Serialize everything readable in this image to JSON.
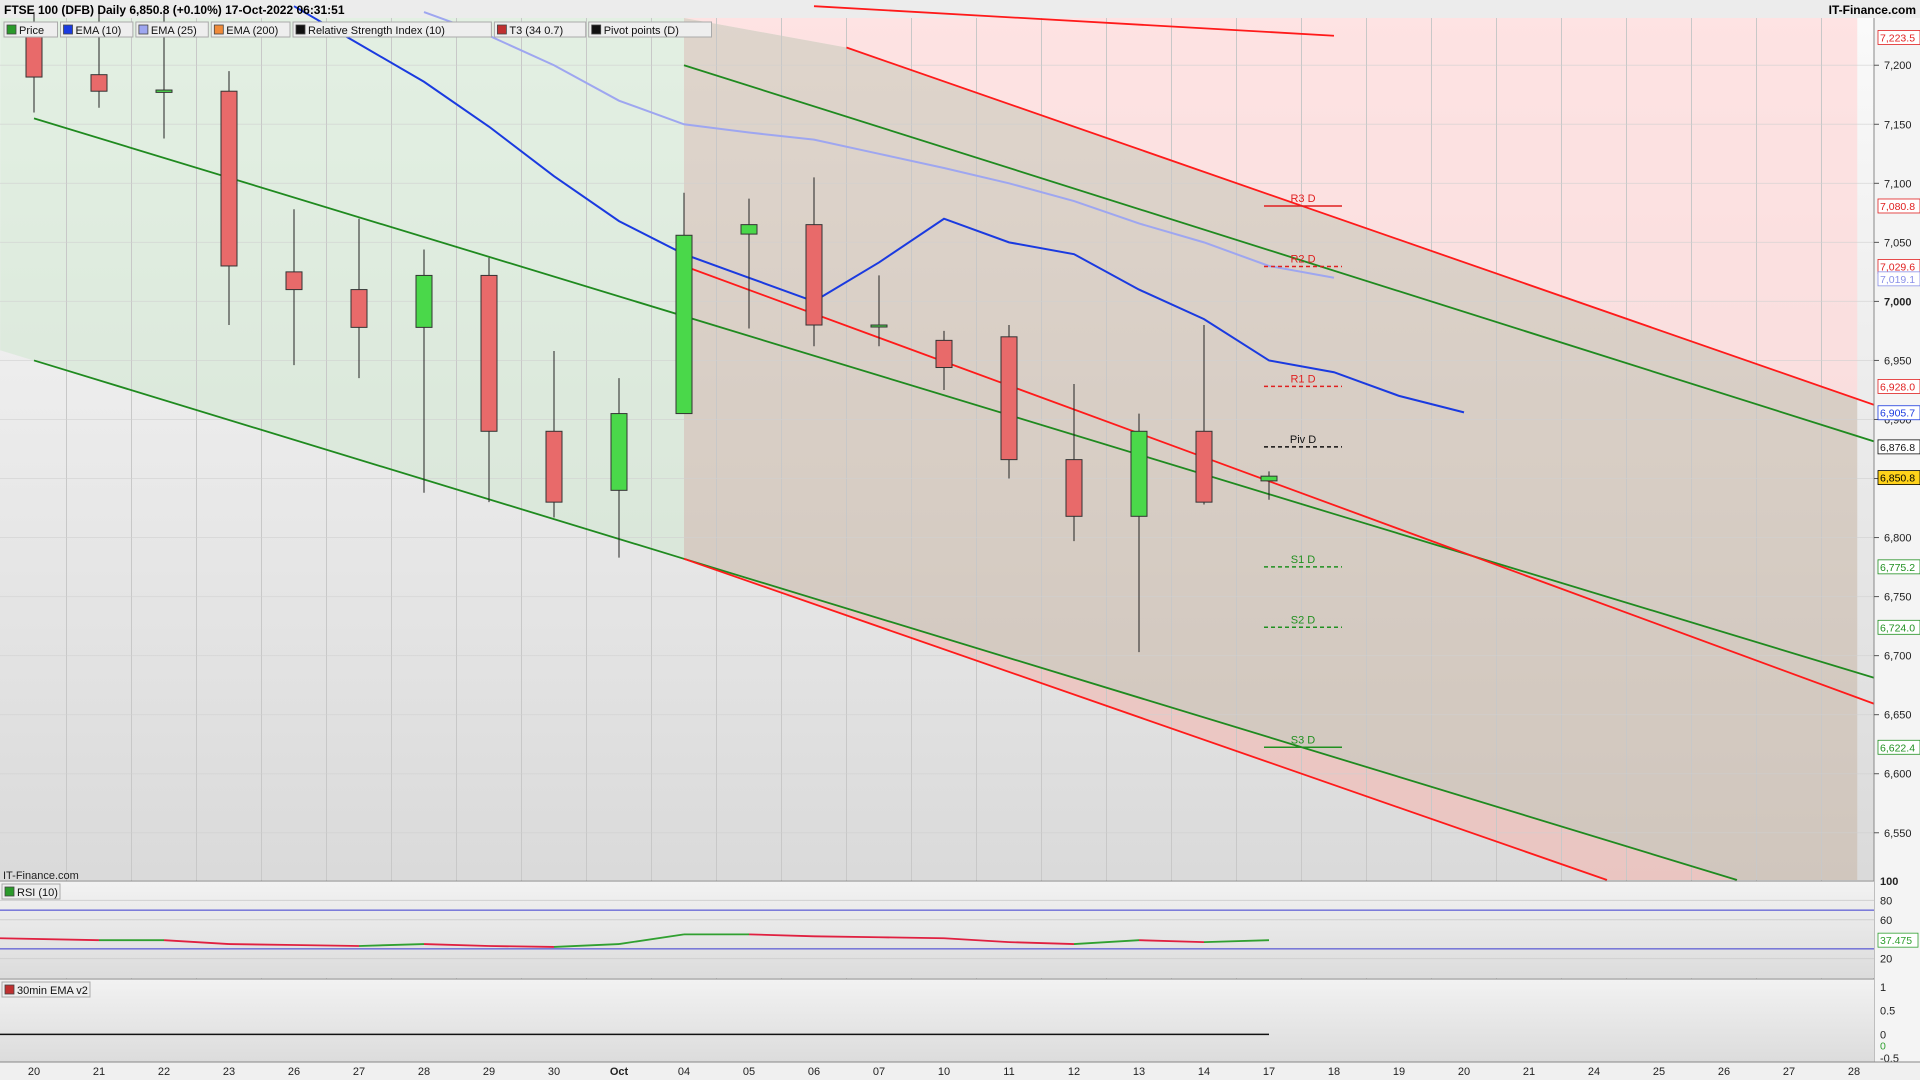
{
  "header": {
    "title": "FTSE 100 (DFB) Daily 6,850.8 (+0.10%) 17-Oct-2022 06:31:51",
    "site": "IT-Finance.com"
  },
  "legend": [
    {
      "label": "Price",
      "color": "#2a9a2a"
    },
    {
      "label": "EMA (10)",
      "color": "#1a3ae0"
    },
    {
      "label": "EMA (25)",
      "color": "#9ea6f0"
    },
    {
      "label": "EMA (200)",
      "color": "#f08a3a"
    },
    {
      "label": "Relative Strength Index (10)",
      "color": "#111111"
    },
    {
      "label": "T3 (34 0.7)",
      "color": "#c03030"
    },
    {
      "label": "Pivot points (D)",
      "color": "#111111"
    }
  ],
  "watermark": "IT-Finance.com",
  "rsi_label": "RSI (10)",
  "ema30_label": "30min EMA v2",
  "chart_data": {
    "type": "candlestick",
    "x_labels": [
      "20",
      "21",
      "22",
      "23",
      "26",
      "27",
      "28",
      "29",
      "30",
      "Oct",
      "04",
      "05",
      "06",
      "07",
      "10",
      "11",
      "12",
      "13",
      "14",
      "17",
      "18",
      "19",
      "20",
      "21",
      "24",
      "25",
      "26",
      "27",
      "28"
    ],
    "y_ticks": [
      "7,200",
      "7,150",
      "7,100",
      "7,050",
      "7,000",
      "6,950",
      "6,900",
      "6,850",
      "6,800",
      "6,750",
      "6,700",
      "6,650",
      "6,600",
      "6,550"
    ],
    "y_range": [
      6510,
      7240
    ],
    "candles": [
      {
        "date": "20",
        "open": 7227,
        "high": 7245,
        "low": 7160,
        "close": 7190
      },
      {
        "date": "21",
        "open": 7192,
        "high": 7245,
        "low": 7164,
        "close": 7178
      },
      {
        "date": "22",
        "open": 7177,
        "high": 7245,
        "low": 7138,
        "close": 7179
      },
      {
        "date": "23",
        "open": 7178,
        "high": 7195,
        "low": 6980,
        "close": 7030
      },
      {
        "date": "26",
        "open": 7025,
        "high": 7078,
        "low": 6946,
        "close": 7010
      },
      {
        "date": "27",
        "open": 7010,
        "high": 7070,
        "low": 6935,
        "close": 6978
      },
      {
        "date": "28",
        "open": 6978,
        "high": 7044,
        "low": 6838,
        "close": 7022
      },
      {
        "date": "29",
        "open": 7022,
        "high": 7037,
        "low": 6830,
        "close": 6890
      },
      {
        "date": "30",
        "open": 6890,
        "high": 6958,
        "low": 6817,
        "close": 6830
      },
      {
        "date": "Oct",
        "open": 6840,
        "high": 6935,
        "low": 6783,
        "close": 6905
      },
      {
        "date": "04",
        "open": 6905,
        "high": 7092,
        "low": 6905,
        "close": 7056
      },
      {
        "date": "05",
        "open": 7057,
        "high": 7087,
        "low": 6977,
        "close": 7065
      },
      {
        "date": "06",
        "open": 7065,
        "high": 7105,
        "low": 6962,
        "close": 6980
      },
      {
        "date": "07",
        "open": 6980,
        "high": 7022,
        "low": 6962,
        "close": 6980
      },
      {
        "date": "10",
        "open": 6967,
        "high": 6975,
        "low": 6925,
        "close": 6944
      },
      {
        "date": "11",
        "open": 6970,
        "high": 6980,
        "low": 6850,
        "close": 6866
      },
      {
        "date": "12",
        "open": 6866,
        "high": 6930,
        "low": 6797,
        "close": 6818
      },
      {
        "date": "13",
        "open": 6818,
        "high": 6905,
        "low": 6703,
        "close": 6890
      },
      {
        "date": "14",
        "open": 6890,
        "high": 6980,
        "low": 6828,
        "close": 6830
      },
      {
        "date": "17",
        "open": 6848,
        "high": 6856,
        "low": 6832,
        "close": 6852
      }
    ],
    "ema10": [
      [
        4,
        7250
      ],
      [
        5,
        7218
      ],
      [
        6,
        7186
      ],
      [
        7,
        7148
      ],
      [
        8,
        7106
      ],
      [
        9,
        7068
      ],
      [
        10,
        7040
      ],
      [
        11,
        7020
      ],
      [
        12,
        7000
      ],
      [
        13,
        7033
      ],
      [
        14,
        7070
      ],
      [
        15,
        7050
      ],
      [
        16,
        7040
      ],
      [
        17,
        7010
      ],
      [
        18,
        6985
      ],
      [
        19,
        6950
      ],
      [
        20,
        6940
      ],
      [
        21,
        6920
      ],
      [
        22,
        6906
      ]
    ],
    "ema25": [
      [
        6,
        7245
      ],
      [
        7,
        7225
      ],
      [
        8,
        7200
      ],
      [
        9,
        7170
      ],
      [
        10,
        7150
      ],
      [
        11,
        7143
      ],
      [
        12,
        7137
      ],
      [
        13,
        7125
      ],
      [
        14,
        7113
      ],
      [
        15,
        7100
      ],
      [
        16,
        7085
      ],
      [
        17,
        7066
      ],
      [
        18,
        7050
      ],
      [
        19,
        7030
      ],
      [
        20,
        7020
      ]
    ],
    "trend_lines": {
      "green_upper": [
        [
          0,
          7155
        ],
        [
          20,
          6820
        ],
        [
          30,
          6653
        ]
      ],
      "green_mid": [
        [
          10,
          7200
        ],
        [
          30,
          6852
        ]
      ],
      "green_lower": [
        [
          0,
          6950
        ],
        [
          10,
          6782
        ],
        [
          26.2,
          6510
        ]
      ],
      "red_upper": [
        [
          12,
          7250
        ],
        [
          20,
          7225
        ]
      ],
      "red_upper2": [
        [
          12.5,
          7215
        ],
        [
          30,
          6880
        ]
      ],
      "red_mid": [
        [
          10,
          7030
        ],
        [
          30,
          6625
        ]
      ],
      "red_lower": [
        [
          10,
          6782
        ],
        [
          24.2,
          6510
        ]
      ]
    },
    "shade": {
      "green_end_index": 10,
      "red_start_index": 10
    },
    "pivots": [
      {
        "label": "R3 D",
        "value": 7080.8,
        "color": "#e02020",
        "style": "solid"
      },
      {
        "label": "R2 D",
        "value": 7029.6,
        "color": "#e02020",
        "style": "dashed"
      },
      {
        "label": "R1 D",
        "value": 6928.0,
        "color": "#e02020",
        "style": "dashed"
      },
      {
        "label": "Piv D",
        "value": 6876.8,
        "color": "#111111",
        "style": "dashed"
      },
      {
        "label": "S1 D",
        "value": 6775.2,
        "color": "#209020",
        "style": "dashed"
      },
      {
        "label": "S2 D",
        "value": 6724.0,
        "color": "#209020",
        "style": "dashed"
      },
      {
        "label": "S3 D",
        "value": 6622.4,
        "color": "#209020",
        "style": "solid"
      }
    ],
    "price_tags": [
      {
        "text": "7,223.5",
        "value": 7223.5,
        "color": "#e02020",
        "bg": "#ffffff"
      },
      {
        "text": "7,080.8",
        "value": 7080.8,
        "color": "#e02020",
        "bg": "#ffffff"
      },
      {
        "text": "7,029.6",
        "value": 7029.6,
        "color": "#e02020",
        "bg": "#ffffff"
      },
      {
        "text": "7,019.1",
        "value": 7019.1,
        "color": "#8a90e8",
        "bg": "#ffffff"
      },
      {
        "text": "6,928.0",
        "value": 6928.0,
        "color": "#e02020",
        "bg": "#ffffff"
      },
      {
        "text": "6,905.7",
        "value": 6905.7,
        "color": "#1a3ae0",
        "bg": "#ffffff"
      },
      {
        "text": "6,876.8",
        "value": 6876.8,
        "color": "#111111",
        "bg": "#ffffff"
      },
      {
        "text": "6,850.8",
        "value": 6850.8,
        "color": "#000000",
        "bg": "#ffd21a"
      },
      {
        "text": "6,775.2",
        "value": 6775.2,
        "color": "#209020",
        "bg": "#ffffff"
      },
      {
        "text": "6,724.0",
        "value": 6724.0,
        "color": "#209020",
        "bg": "#ffffff"
      },
      {
        "text": "6,622.4",
        "value": 6622.4,
        "color": "#209020",
        "bg": "#ffffff"
      }
    ],
    "rsi": {
      "ticks": [
        "100",
        "80",
        "60",
        "20"
      ],
      "range": [
        0,
        100
      ],
      "upper_band": 70,
      "lower_band": 30,
      "values": [
        [
          0,
          41
        ],
        [
          1,
          39
        ],
        [
          2,
          39
        ],
        [
          3,
          35
        ],
        [
          4,
          34
        ],
        [
          5,
          33
        ],
        [
          6,
          35
        ],
        [
          7,
          33
        ],
        [
          8,
          32
        ],
        [
          9,
          35
        ],
        [
          10,
          45
        ],
        [
          11,
          45
        ],
        [
          12,
          43
        ],
        [
          13,
          42
        ],
        [
          14,
          41
        ],
        [
          15,
          37
        ],
        [
          16,
          35
        ],
        [
          17,
          39
        ],
        [
          18,
          37
        ],
        [
          19,
          39
        ]
      ],
      "current": "37.475"
    },
    "ema30": {
      "ticks": [
        "1",
        "0.5",
        "0",
        "-0.5"
      ],
      "range": [
        -0.5,
        1
      ],
      "line_value": 0,
      "tag": "0"
    }
  }
}
